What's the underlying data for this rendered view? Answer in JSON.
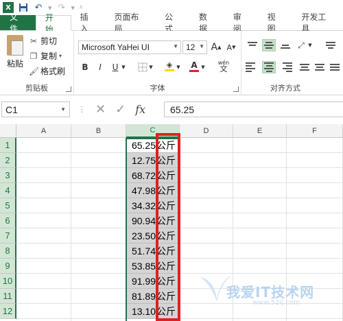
{
  "app": {
    "name": "Excel"
  },
  "quick_access": {
    "save": "save-icon",
    "undo": "undo-icon",
    "redo": "redo-icon",
    "customize": "customize-icon"
  },
  "tabs": [
    {
      "label": "文件",
      "kind": "file"
    },
    {
      "label": "开始",
      "kind": "active"
    },
    {
      "label": "插入"
    },
    {
      "label": "页面布局"
    },
    {
      "label": "公式"
    },
    {
      "label": "数据"
    },
    {
      "label": "审阅"
    },
    {
      "label": "视图"
    },
    {
      "label": "开发工具"
    }
  ],
  "ribbon": {
    "clipboard": {
      "label": "剪贴板",
      "paste": "粘贴",
      "cut": "剪切",
      "copy": "复制",
      "format_painter": "格式刷"
    },
    "font": {
      "label": "字体",
      "name": "Microsoft YaHei UI",
      "size": "12",
      "bold": "B",
      "italic": "I",
      "underline": "U",
      "grow": "A",
      "shrink": "A",
      "phonetic": "wén",
      "font_color": "#e02020",
      "fill_color": "#ffd700"
    },
    "alignment": {
      "label": "对齐方式"
    }
  },
  "formula_bar": {
    "name_box": "C1",
    "cancel": "✕",
    "enter": "✓",
    "fx": "fx",
    "value": "65.25"
  },
  "sheet": {
    "columns": [
      "A",
      "B",
      "C",
      "D",
      "E",
      "F"
    ],
    "selected_column": "C",
    "rows": [
      {
        "row": "1",
        "value": "65.25",
        "unit": "公斤"
      },
      {
        "row": "2",
        "value": "12.75",
        "unit": "公斤"
      },
      {
        "row": "3",
        "value": "68.72",
        "unit": "公斤"
      },
      {
        "row": "4",
        "value": "47.98",
        "unit": "公斤"
      },
      {
        "row": "5",
        "value": "34.32",
        "unit": "公斤"
      },
      {
        "row": "6",
        "value": "90.94",
        "unit": "公斤"
      },
      {
        "row": "7",
        "value": "23.50",
        "unit": "公斤"
      },
      {
        "row": "8",
        "value": "51.74",
        "unit": "公斤"
      },
      {
        "row": "9",
        "value": "53.85",
        "unit": "公斤"
      },
      {
        "row": "10",
        "value": "91.99",
        "unit": "公斤"
      },
      {
        "row": "11",
        "value": "81.89",
        "unit": "公斤"
      },
      {
        "row": "12",
        "value": "13.10",
        "unit": "公斤"
      }
    ],
    "highlight_color": "#e02020",
    "selection_color": "#217346"
  },
  "watermark": {
    "text": "我爱IT技术网",
    "sub": "www.52ij.com"
  }
}
